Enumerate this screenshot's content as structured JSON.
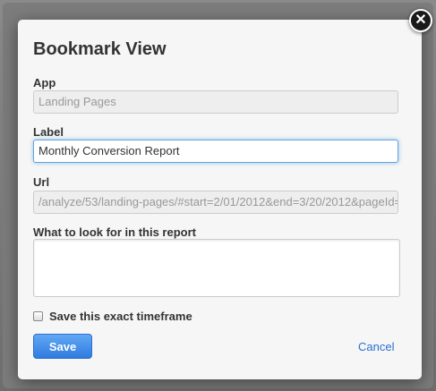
{
  "dialog": {
    "title": "Bookmark View",
    "close_symbol": "✕",
    "app": {
      "label": "App",
      "value": "Landing Pages"
    },
    "label_field": {
      "label": "Label",
      "value": "Monthly Conversion Report"
    },
    "url": {
      "label": "Url",
      "value": "/analyze/53/landing-pages/#start=2/01/2012&end=3/20/2012&pageId="
    },
    "notes": {
      "label": "What to look for in this report",
      "value": ""
    },
    "timeframe_checkbox": {
      "label": "Save this exact timeframe",
      "checked": false
    },
    "save_label": "Save",
    "cancel_label": "Cancel"
  },
  "colors": {
    "primary": "#2f7be0",
    "link": "#2a6fcf",
    "focus": "#6aa2d9"
  },
  "icons": {
    "close": "close-icon"
  }
}
